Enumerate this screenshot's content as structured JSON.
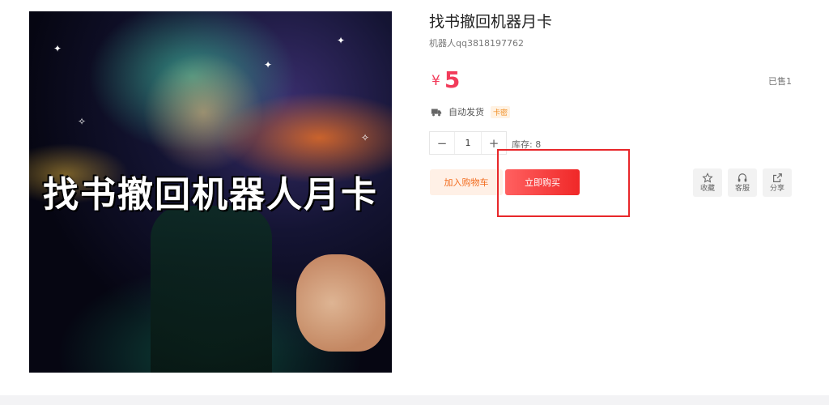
{
  "product": {
    "image_caption": "找书撤回机器人月卡",
    "title": "找书撤回机器月卡",
    "seller": "机器人qq3818197762",
    "price_currency": "¥",
    "price": "5",
    "sold": "已售1",
    "delivery_label": "自动发货",
    "delivery_badge": "卡密"
  },
  "quantity": {
    "minus": "−",
    "value": "1",
    "plus": "+",
    "stock": "库存: 8"
  },
  "buttons": {
    "add_to_cart": "加入购物车",
    "buy_now": "立即购买"
  },
  "actions": {
    "favorite": "收藏",
    "service": "客服",
    "share": "分享"
  },
  "colors": {
    "price": "#f23b5a",
    "buy_now": "#f02828",
    "add_to_cart_text": "#f26b1d",
    "highlight": "#e8272a"
  },
  "icons": [
    "truck-icon",
    "star-icon",
    "headset-icon",
    "share-icon"
  ]
}
